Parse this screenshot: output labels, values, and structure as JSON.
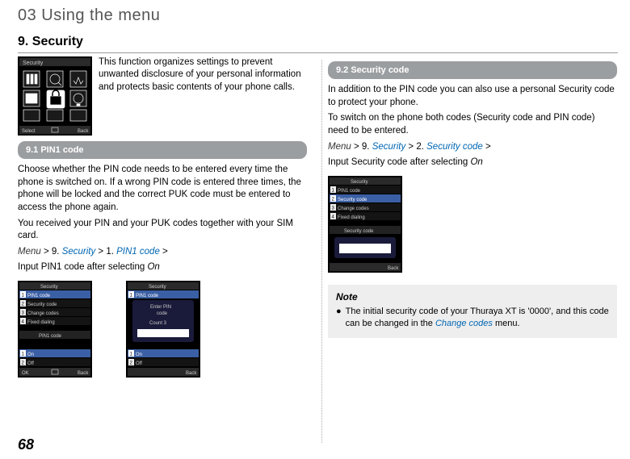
{
  "chapter": "03 Using the menu",
  "section_title": "9. Security",
  "page_number": "68",
  "intro": "This function organizes settings to prevent unwanted disclosure of your personal information and protects basic contents of your phone calls.",
  "s91": {
    "header": "9.1  PIN1 code",
    "p1": "Choose whether the PIN code needs to be entered every time the phone is switched on.  If a wrong PIN code is entered three times, the phone will be locked and the correct PUK code must be entered to access the phone again.",
    "p2": "You received your PIN and your PUK codes together with your SIM card.",
    "path_menu": "Menu",
    "path_gt1": " > 9. ",
    "path_sec": "Security",
    "path_gt2": " > 1. ",
    "path_pin": "PIN1 code",
    "path_gt3": " >",
    "p3a": "Input PIN1 code after selecting ",
    "p3b": "On"
  },
  "s92": {
    "header": "9.2  Security code",
    "p1": "In addition to the PIN code you can also use a personal Security code to protect your phone.",
    "p2": "To switch on the phone both codes (Security code and PIN code) need to be entered.",
    "path_menu": "Menu",
    "path_gt1": " > 9. ",
    "path_sec": "Security",
    "path_gt2": " > 2. ",
    "path_scode": "Security code",
    "path_gt3": " >",
    "p3a": "Input Security code after selecting ",
    "p3b": "On"
  },
  "note": {
    "title": "Note",
    "text1": "The initial security code of your Thuraya XT is '0000', and this code can be changed in the ",
    "text2": "Change codes",
    "text3": " menu."
  },
  "phone_icons": {
    "title": "Security",
    "select": "Select",
    "back": "Back",
    "ok": "OK"
  },
  "phone_list": {
    "title": "Security",
    "i1": "PIN1 code",
    "i2": "Security code",
    "i3": "Change codes",
    "i4": "Fixed dialing",
    "popup_pin1": "PIN1 code",
    "popup_enter": "Enter PIN code",
    "popup_count": "Count  3",
    "popup_seccode": "Security code",
    "on": "On",
    "off": "Off"
  }
}
